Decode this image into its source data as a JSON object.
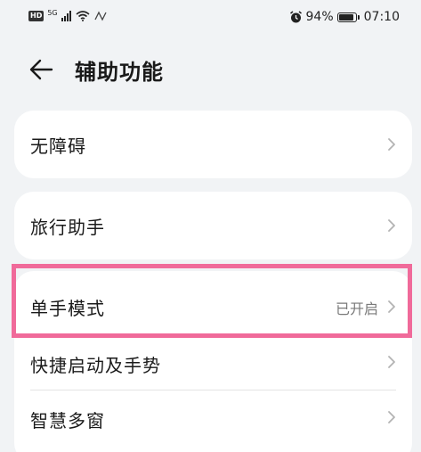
{
  "status_bar": {
    "network_badge": "HD",
    "signal_label": "5G",
    "battery_percent": "94%",
    "time": "07:10"
  },
  "header": {
    "title": "辅助功能"
  },
  "groups": [
    {
      "items": [
        {
          "label": "无障碍",
          "value": ""
        }
      ]
    },
    {
      "items": [
        {
          "label": "旅行助手",
          "value": ""
        }
      ]
    },
    {
      "items": [
        {
          "label": "单手模式",
          "value": "已开启"
        },
        {
          "label": "快捷启动及手势",
          "value": ""
        },
        {
          "label": "智慧多窗",
          "value": ""
        }
      ]
    }
  ],
  "colors": {
    "highlight": "#f06a9a",
    "background": "#f1f3f5",
    "card": "#ffffff"
  }
}
